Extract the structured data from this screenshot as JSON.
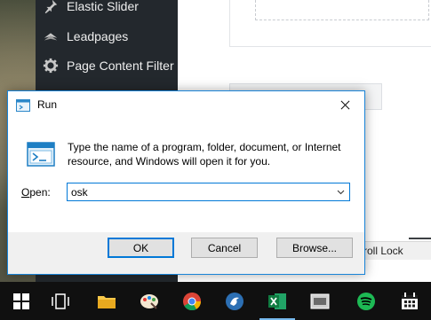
{
  "wp_sidebar": {
    "items": [
      {
        "label": "Elastic Slider",
        "icon": "pin-icon"
      },
      {
        "label": "Leadpages",
        "icon": "leadpages-icon"
      },
      {
        "label": "Page Content Filter",
        "icon": "gear-icon"
      }
    ]
  },
  "background": {
    "status_text": "roll Lock"
  },
  "run_dialog": {
    "title": "Run",
    "description": "Type the name of a program, folder, document, or Internet resource, and Windows will open it for you.",
    "open_label_hotkey": "O",
    "open_label_rest": "pen:",
    "input_value": "osk",
    "ok_label": "OK",
    "cancel_label": "Cancel",
    "browse_label": "Browse...",
    "colors": {
      "accent": "#0078d7",
      "button_bg": "#e1e1e1",
      "dialog_bg": "#f0f0f0"
    }
  },
  "taskbar": {
    "items": [
      "windows-start-icon",
      "task-view-icon",
      "file-explorer-icon",
      "paint-icon",
      "chrome-icon",
      "app-bird-icon",
      "excel-icon",
      "sxd-app-icon",
      "spotify-icon",
      "calendar-icon"
    ]
  }
}
